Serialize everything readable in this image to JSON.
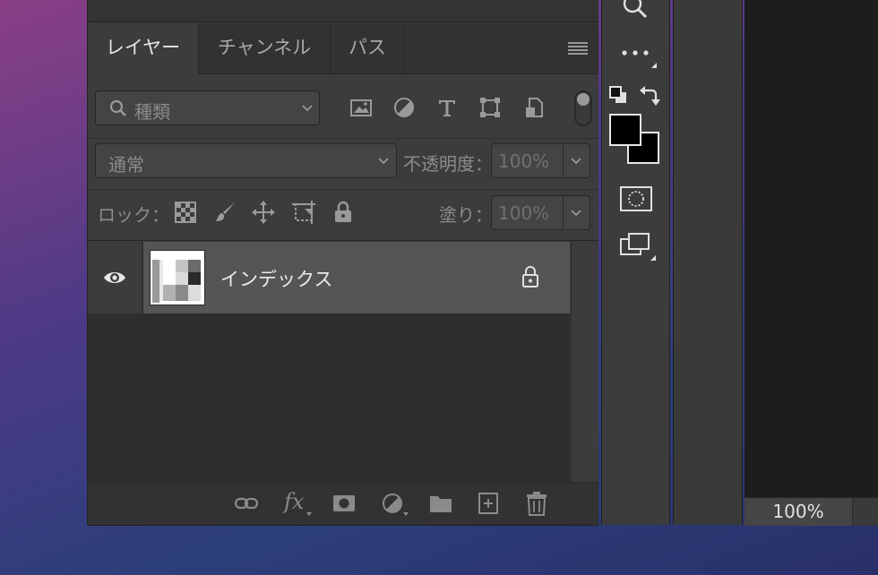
{
  "layers_panel": {
    "tabs": [
      {
        "label": "レイヤー",
        "active": true
      },
      {
        "label": "チャンネル",
        "active": false
      },
      {
        "label": "パス",
        "active": false
      }
    ],
    "filter": {
      "placeholder": "種類",
      "filter_icons": [
        "image-filter-icon",
        "adjustment-filter-icon",
        "type-filter-icon",
        "shape-filter-icon",
        "smart-object-filter-icon"
      ]
    },
    "blend_mode": "通常",
    "opacity_label": "不透明度：",
    "opacity_value": "100%",
    "lock_label": "ロック：",
    "lock_icons": [
      "lock-transparent-pixels-icon",
      "lock-image-pixels-icon",
      "lock-position-icon",
      "lock-artboard-icon",
      "lock-all-icon"
    ],
    "fill_label": "塗り：",
    "fill_value": "100%",
    "layers": [
      {
        "name": "インデックス",
        "visible": true,
        "locked": true
      }
    ],
    "bottom_icons": [
      "link-layers-icon",
      "fx-icon",
      "add-mask-icon",
      "new-adjustment-layer-icon",
      "new-group-icon",
      "new-layer-icon",
      "delete-layer-icon"
    ],
    "fx_label": "fx"
  },
  "toolbar": {
    "tools": [
      "zoom-tool-icon",
      "more-tools-icon",
      "default-colors-icon",
      "swap-colors-icon",
      "foreground-color",
      "background-color",
      "quick-mask-icon",
      "screen-mode-icon"
    ],
    "foreground_color": "#000000",
    "background_color": "#000000"
  },
  "document": {
    "zoom_level": "100%"
  }
}
